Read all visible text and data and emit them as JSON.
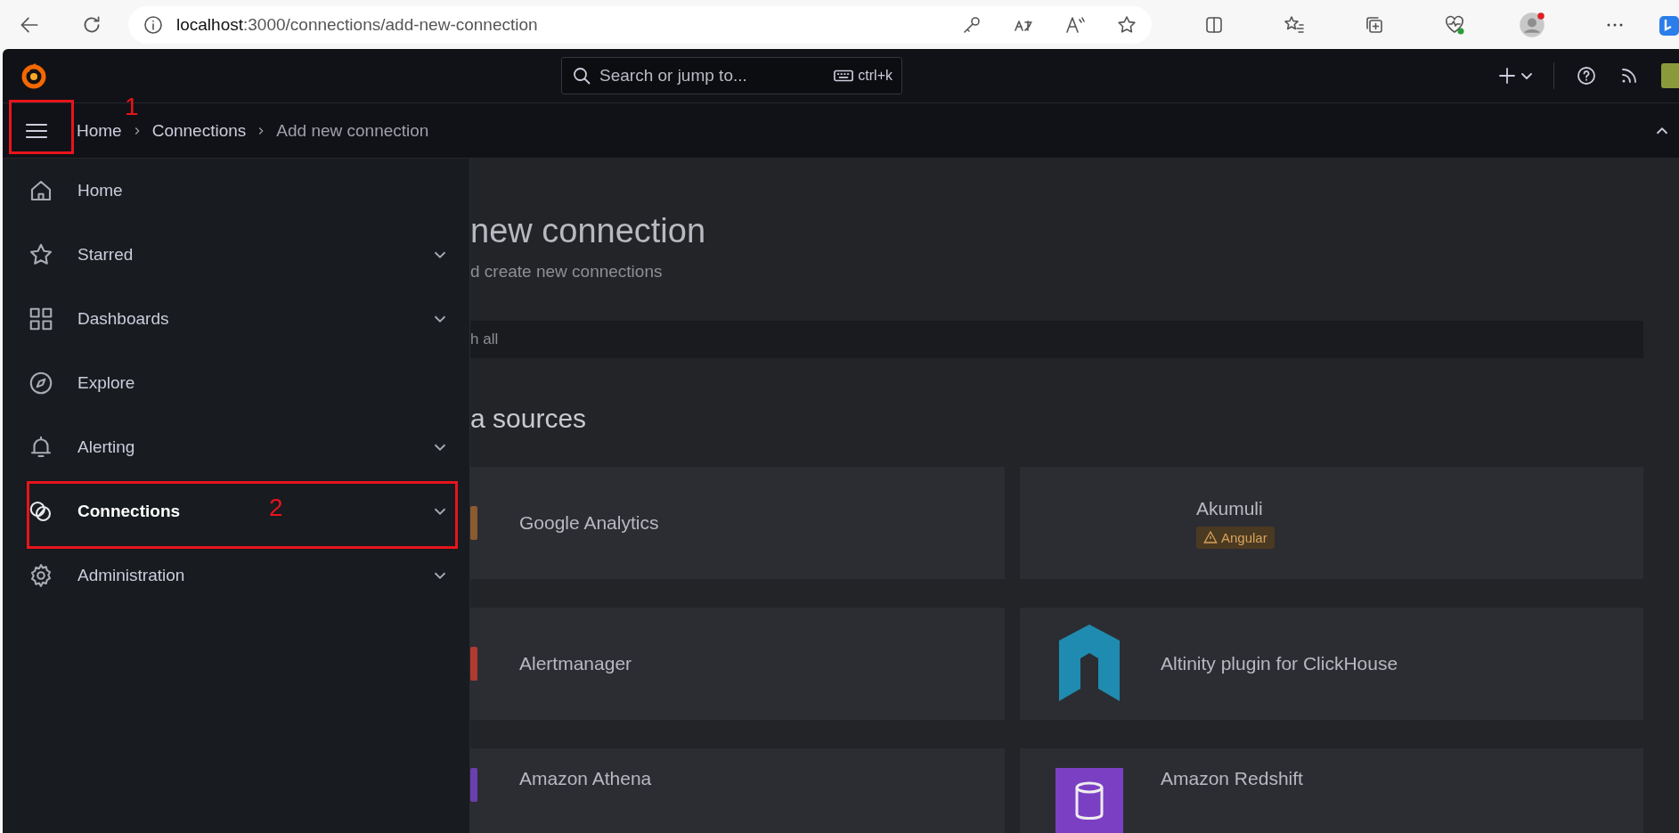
{
  "browser": {
    "url_host": "localhost",
    "url_path": ":3000/connections/add-new-connection"
  },
  "topbar": {
    "search_placeholder": "Search or jump to...",
    "shortcut": "ctrl+k"
  },
  "breadcrumbs": [
    {
      "label": "Home",
      "current": false
    },
    {
      "label": "Connections",
      "current": false
    },
    {
      "label": "Add new connection",
      "current": true
    }
  ],
  "sidebar": {
    "items": [
      {
        "label": "Home",
        "expandable": false,
        "selected": false
      },
      {
        "label": "Starred",
        "expandable": true,
        "selected": false
      },
      {
        "label": "Dashboards",
        "expandable": true,
        "selected": false
      },
      {
        "label": "Explore",
        "expandable": false,
        "selected": false
      },
      {
        "label": "Alerting",
        "expandable": true,
        "selected": false
      },
      {
        "label": "Connections",
        "expandable": true,
        "selected": true
      },
      {
        "label": "Administration",
        "expandable": true,
        "selected": false
      }
    ]
  },
  "page": {
    "title": "new connection",
    "subtitle": "d create new connections",
    "search": {
      "placeholder": "h all"
    },
    "section_title": "a sources",
    "cards": [
      {
        "name": "Google Analytics"
      },
      {
        "name": "Akumuli",
        "badge": "Angular"
      },
      {
        "name": "Alertmanager"
      },
      {
        "name": "Altinity plugin for ClickHouse"
      },
      {
        "name": "Amazon Athena"
      },
      {
        "name": "Amazon Redshift"
      }
    ]
  },
  "annotations": [
    {
      "label": "1"
    },
    {
      "label": "2"
    }
  ]
}
